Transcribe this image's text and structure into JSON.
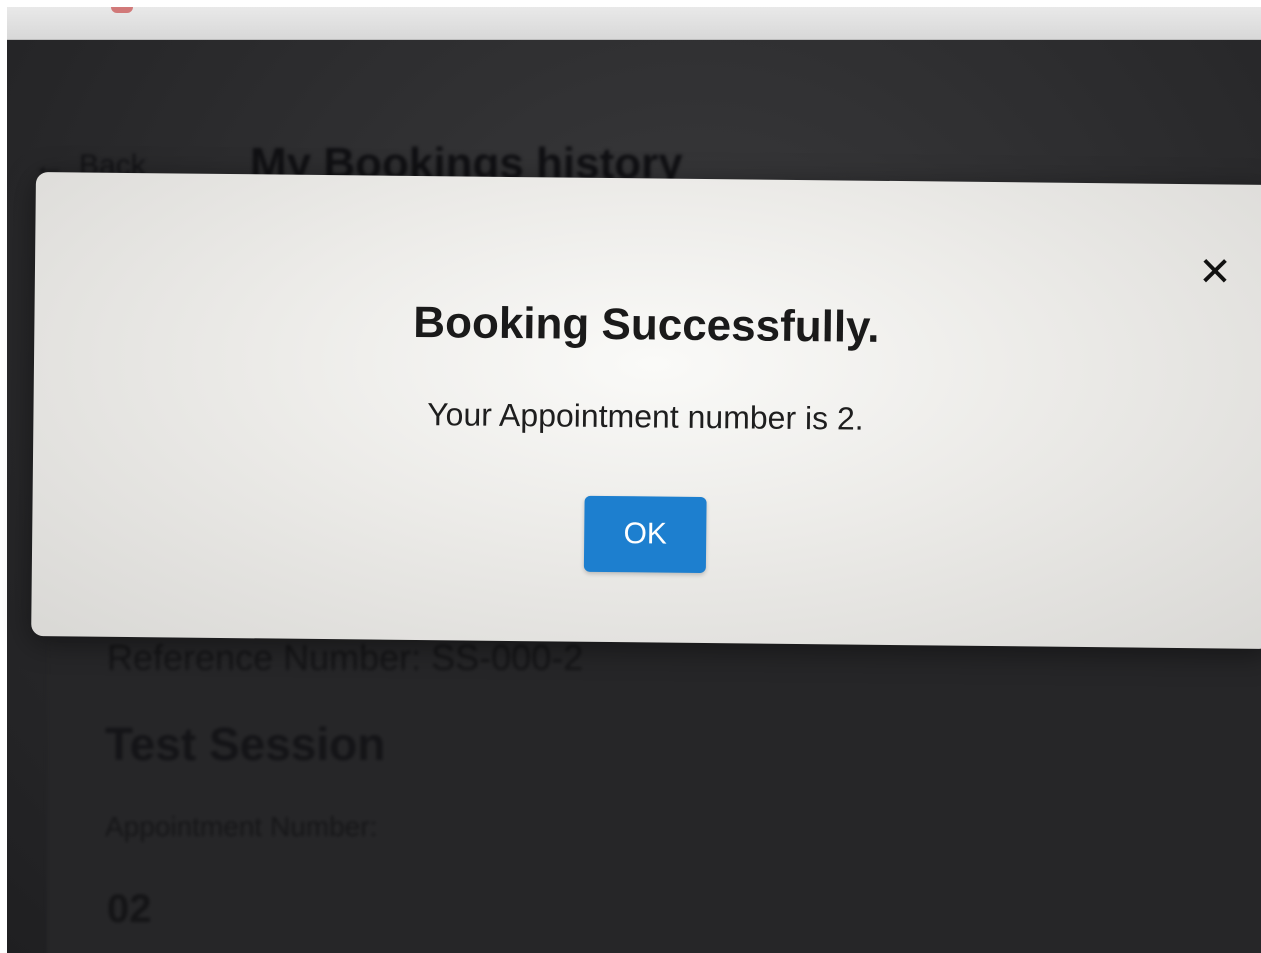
{
  "background_page": {
    "back_label": "Back",
    "page_title": "My Bookings history",
    "reference_text": "Reference Number: SS-000-2",
    "session_title": "Test Session",
    "appointment_label": "Appointment Number:",
    "appointment_value": "02"
  },
  "modal": {
    "title": "Booking Successfully.",
    "message": "Your Appointment number is 2.",
    "ok_label": "OK",
    "close_glyph": "✕"
  },
  "colors": {
    "ok_button": "#1d7fcf",
    "modal_background": "#ecebe8",
    "overlay": "#2b2b2d"
  }
}
